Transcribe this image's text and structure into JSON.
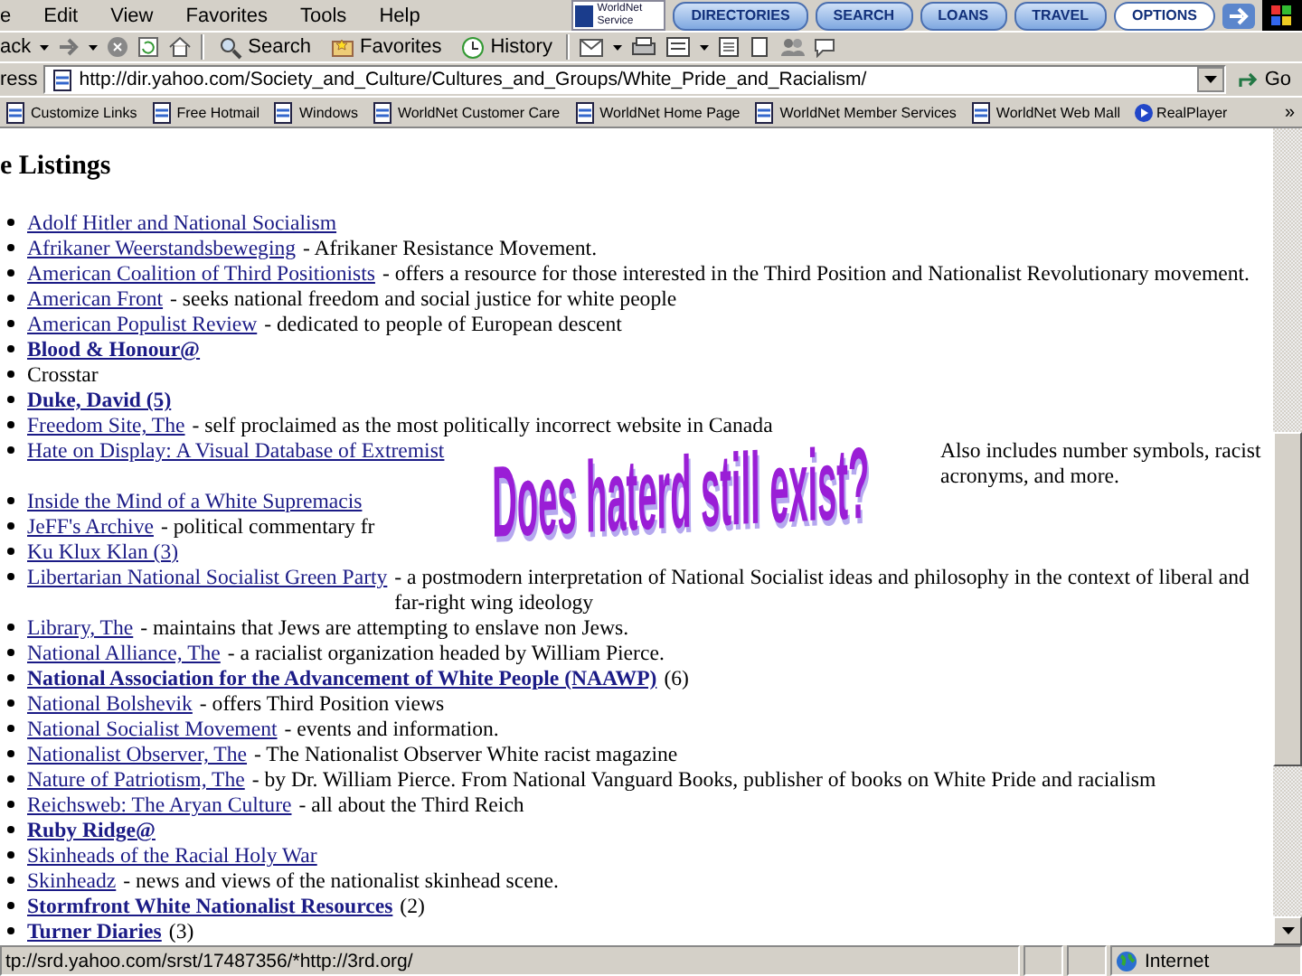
{
  "menu": [
    "e",
    "Edit",
    "View",
    "Favorites",
    "Tools",
    "Help"
  ],
  "banner": {
    "text": "WorldNet Service",
    "buttons": [
      "DIRECTORIES",
      "SEARCH",
      "LOANS",
      "TRAVEL",
      "OPTIONS"
    ]
  },
  "toolbar": {
    "back": "ack",
    "buttons": [
      {
        "kind": "search",
        "label": "Search"
      },
      {
        "kind": "favorites",
        "label": "Favorites"
      },
      {
        "kind": "history",
        "label": "History"
      }
    ]
  },
  "address": {
    "label": "ress",
    "url": "http://dir.yahoo.com/Society_and_Culture/Cultures_and_Groups/White_Pride_and_Racialism/",
    "go": "Go"
  },
  "links": {
    "items": [
      "Customize Links",
      "Free Hotmail",
      "Windows",
      "WorldNet Customer Care",
      "WorldNet Home Page",
      "WorldNet Member Services",
      "WorldNet Web Mall",
      "RealPlayer"
    ],
    "more": "»"
  },
  "page": {
    "heading": "e Listings",
    "items": [
      {
        "kind": "link",
        "name": "Adolf Hitler and National Socialism"
      },
      {
        "kind": "link",
        "name": "Afrikaner Weerstandsbeweging",
        "desc": "- Afrikaner Resistance Movement."
      },
      {
        "kind": "link",
        "name": "American Coalition of Third Positionists",
        "desc": "- offers a resource for those interested in the Third Position and Nationalist Revolutionary movement."
      },
      {
        "kind": "link",
        "name": "American Front",
        "desc": "- seeks national freedom and social justice for white people"
      },
      {
        "kind": "link",
        "name": "American Populist Review",
        "desc": "- dedicated to people of European descent"
      },
      {
        "kind": "bold",
        "name": "Blood & Honour@"
      },
      {
        "kind": "plain",
        "name": "Crosstar"
      },
      {
        "kind": "bold",
        "name": "Duke, David (5)"
      },
      {
        "kind": "link",
        "name": "Freedom Site, The",
        "desc": "- self proclaimed as the most politically incorrect website in Canada"
      },
      {
        "kind": "link",
        "name": "Hate on Display: A Visual Database of Extremist",
        "covered": true,
        "after": "Also includes number symbols, racist acronyms, and more."
      },
      {
        "kind": "link",
        "name": "Inside the Mind of a White Supremacis",
        "covered": true
      },
      {
        "kind": "link",
        "name": "JeFF's Archive",
        "desc": "- political commentary fr",
        "covered": true
      },
      {
        "kind": "link",
        "name": "Ku Klux Klan (3)"
      },
      {
        "kind": "link",
        "name": "Libertarian National Socialist Green Party",
        "desc": "- a postmodern interpretation of National Socialist ideas and philosophy in the context of liberal and far-right wing ideology"
      },
      {
        "kind": "link",
        "name": "Library, The",
        "desc": "- maintains that Jews are attempting to enslave non Jews."
      },
      {
        "kind": "link",
        "name": "National Alliance, The",
        "desc": "- a racialist organization headed by William Pierce."
      },
      {
        "kind": "bold",
        "name": "National Association for the Advancement of White People (NAAWP)",
        "count": "(6)"
      },
      {
        "kind": "link",
        "name": "National Bolshevik",
        "desc": "- offers Third Position views"
      },
      {
        "kind": "link",
        "name": "National Socialist Movement",
        "desc": "- events and information."
      },
      {
        "kind": "link",
        "name": "Nationalist Observer, The",
        "desc": "- The Nationalist Observer White racist magazine"
      },
      {
        "kind": "link",
        "name": "Nature of Patriotism, The",
        "desc": "- by Dr. William Pierce. From National Vanguard Books, publisher of books on White Pride and racialism"
      },
      {
        "kind": "link",
        "name": "Reichsweb: The Aryan Culture",
        "desc": "- all about the Third Reich"
      },
      {
        "kind": "bold",
        "name": "Ruby Ridge@"
      },
      {
        "kind": "link",
        "name": "Skinheads of the Racial Holy War"
      },
      {
        "kind": "link",
        "name": "Skinheadz",
        "desc": "- news and views of the nationalist skinhead scene."
      },
      {
        "kind": "bold",
        "name": "Stormfront White Nationalist Resources",
        "count": "(2)"
      },
      {
        "kind": "bold",
        "name": "Turner Diaries",
        "count": "(3)"
      }
    ]
  },
  "overlay": {
    "text": "Does haterd still exist?"
  },
  "status": {
    "url": "tp://srd.yahoo.com/srst/17487356/*http://3rd.org/",
    "zone": "Internet"
  }
}
